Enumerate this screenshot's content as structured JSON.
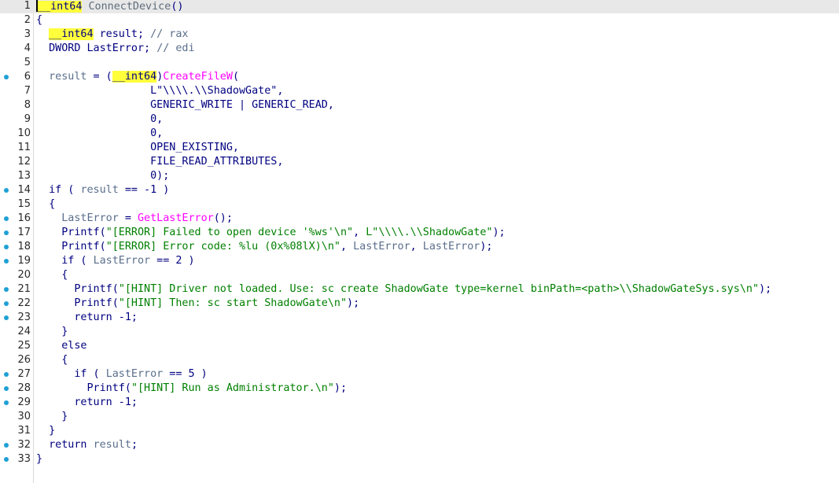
{
  "editor": {
    "lines": [
      {
        "n": "1",
        "marker": false,
        "current": true,
        "tokens": [
          {
            "c": "caret"
          },
          {
            "t": "__int64",
            "c": "typ hl"
          },
          {
            "t": " ",
            "c": "pl"
          },
          {
            "t": "ConnectDevice",
            "c": "fn"
          },
          {
            "t": "()",
            "c": "pl"
          }
        ]
      },
      {
        "n": "2",
        "marker": false,
        "current": false,
        "tokens": [
          {
            "t": "{",
            "c": "pl"
          }
        ]
      },
      {
        "n": "3",
        "marker": false,
        "current": false,
        "tokens": [
          {
            "t": "  ",
            "c": "pl"
          },
          {
            "t": "__int64",
            "c": "typ hl"
          },
          {
            "t": " result; ",
            "c": "pl"
          },
          {
            "t": "// rax",
            "c": "cm"
          }
        ]
      },
      {
        "n": "4",
        "marker": false,
        "current": false,
        "tokens": [
          {
            "t": "  DWORD LastError; ",
            "c": "pl"
          },
          {
            "t": "// edi",
            "c": "cm"
          }
        ]
      },
      {
        "n": "5",
        "marker": false,
        "current": false,
        "tokens": []
      },
      {
        "n": "6",
        "marker": true,
        "current": false,
        "tokens": [
          {
            "t": "  ",
            "c": "pl"
          },
          {
            "t": "result",
            "c": "var"
          },
          {
            "t": " = (",
            "c": "pl"
          },
          {
            "t": "__int64",
            "c": "typ hl"
          },
          {
            "t": ")",
            "c": "pl"
          },
          {
            "t": "CreateFileW",
            "c": "call"
          },
          {
            "t": "(",
            "c": "pl"
          }
        ]
      },
      {
        "n": "7",
        "marker": false,
        "current": false,
        "tokens": [
          {
            "t": "                  ",
            "c": "pl"
          },
          {
            "t": "L\"\\\\\\\\.\\\\ShadowGate\"",
            "c": "pl"
          },
          {
            "t": ",",
            "c": "pl"
          }
        ]
      },
      {
        "n": "8",
        "marker": false,
        "current": false,
        "tokens": [
          {
            "t": "                  GENERIC_WRITE | GENERIC_READ,",
            "c": "pl"
          }
        ]
      },
      {
        "n": "9",
        "marker": false,
        "current": false,
        "tokens": [
          {
            "t": "                  0,",
            "c": "pl"
          }
        ]
      },
      {
        "n": "10",
        "marker": false,
        "current": false,
        "tokens": [
          {
            "t": "                  0,",
            "c": "pl"
          }
        ]
      },
      {
        "n": "11",
        "marker": false,
        "current": false,
        "tokens": [
          {
            "t": "                  OPEN_EXISTING,",
            "c": "pl"
          }
        ]
      },
      {
        "n": "12",
        "marker": false,
        "current": false,
        "tokens": [
          {
            "t": "                  FILE_READ_ATTRIBUTES,",
            "c": "pl"
          }
        ]
      },
      {
        "n": "13",
        "marker": false,
        "current": false,
        "tokens": [
          {
            "t": "                  0);",
            "c": "pl"
          }
        ]
      },
      {
        "n": "14",
        "marker": true,
        "current": false,
        "tokens": [
          {
            "t": "  if ( ",
            "c": "pl"
          },
          {
            "t": "result",
            "c": "var"
          },
          {
            "t": " == -1 )",
            "c": "pl"
          }
        ]
      },
      {
        "n": "15",
        "marker": false,
        "current": false,
        "tokens": [
          {
            "t": "  {",
            "c": "pl"
          }
        ]
      },
      {
        "n": "16",
        "marker": true,
        "current": false,
        "tokens": [
          {
            "t": "    ",
            "c": "pl"
          },
          {
            "t": "LastError",
            "c": "var"
          },
          {
            "t": " = ",
            "c": "pl"
          },
          {
            "t": "GetLastError",
            "c": "call"
          },
          {
            "t": "();",
            "c": "pl"
          }
        ]
      },
      {
        "n": "17",
        "marker": true,
        "current": false,
        "tokens": [
          {
            "t": "    Printf(",
            "c": "pl"
          },
          {
            "t": "\"[ERROR] Failed to open device '%ws'\\n\"",
            "c": "str"
          },
          {
            "t": ", ",
            "c": "pl"
          },
          {
            "t": "L\"\\\\\\\\.\\\\ShadowGate\"",
            "c": "str"
          },
          {
            "t": ");",
            "c": "pl"
          }
        ]
      },
      {
        "n": "18",
        "marker": true,
        "current": false,
        "tokens": [
          {
            "t": "    Printf(",
            "c": "pl"
          },
          {
            "t": "\"[ERROR] Error code: %lu (0x%08lX)\\n\"",
            "c": "str"
          },
          {
            "t": ", ",
            "c": "pl"
          },
          {
            "t": "LastError",
            "c": "var"
          },
          {
            "t": ", ",
            "c": "pl"
          },
          {
            "t": "LastError",
            "c": "var"
          },
          {
            "t": ");",
            "c": "pl"
          }
        ]
      },
      {
        "n": "19",
        "marker": true,
        "current": false,
        "tokens": [
          {
            "t": "    if ( ",
            "c": "pl"
          },
          {
            "t": "LastError",
            "c": "var"
          },
          {
            "t": " == 2 )",
            "c": "pl"
          }
        ]
      },
      {
        "n": "20",
        "marker": false,
        "current": false,
        "tokens": [
          {
            "t": "    {",
            "c": "pl"
          }
        ]
      },
      {
        "n": "21",
        "marker": true,
        "current": false,
        "tokens": [
          {
            "t": "      Printf(",
            "c": "pl"
          },
          {
            "t": "\"[HINT] Driver not loaded. Use: sc create ShadowGate type=kernel binPath=<path>\\\\ShadowGateSys.sys\\n\"",
            "c": "str"
          },
          {
            "t": ");",
            "c": "pl"
          }
        ]
      },
      {
        "n": "22",
        "marker": true,
        "current": false,
        "tokens": [
          {
            "t": "      Printf(",
            "c": "pl"
          },
          {
            "t": "\"[HINT] Then: sc start ShadowGate\\n\"",
            "c": "str"
          },
          {
            "t": ");",
            "c": "pl"
          }
        ]
      },
      {
        "n": "23",
        "marker": true,
        "current": false,
        "tokens": [
          {
            "t": "      return -1;",
            "c": "pl"
          }
        ]
      },
      {
        "n": "24",
        "marker": false,
        "current": false,
        "tokens": [
          {
            "t": "    }",
            "c": "pl"
          }
        ]
      },
      {
        "n": "25",
        "marker": false,
        "current": false,
        "tokens": [
          {
            "t": "    else",
            "c": "pl"
          }
        ]
      },
      {
        "n": "26",
        "marker": false,
        "current": false,
        "tokens": [
          {
            "t": "    {",
            "c": "pl"
          }
        ]
      },
      {
        "n": "27",
        "marker": true,
        "current": false,
        "tokens": [
          {
            "t": "      if ( ",
            "c": "pl"
          },
          {
            "t": "LastError",
            "c": "var"
          },
          {
            "t": " == 5 )",
            "c": "pl"
          }
        ]
      },
      {
        "n": "28",
        "marker": true,
        "current": false,
        "tokens": [
          {
            "t": "        Printf(",
            "c": "pl"
          },
          {
            "t": "\"[HINT] Run as Administrator.\\n\"",
            "c": "str"
          },
          {
            "t": ");",
            "c": "pl"
          }
        ]
      },
      {
        "n": "29",
        "marker": true,
        "current": false,
        "tokens": [
          {
            "t": "      return -1;",
            "c": "pl"
          }
        ]
      },
      {
        "n": "30",
        "marker": false,
        "current": false,
        "tokens": [
          {
            "t": "    }",
            "c": "pl"
          }
        ]
      },
      {
        "n": "31",
        "marker": false,
        "current": false,
        "tokens": [
          {
            "t": "  }",
            "c": "pl"
          }
        ]
      },
      {
        "n": "32",
        "marker": true,
        "current": false,
        "tokens": [
          {
            "t": "  return ",
            "c": "pl"
          },
          {
            "t": "result",
            "c": "var"
          },
          {
            "t": ";",
            "c": "pl"
          }
        ]
      },
      {
        "n": "33",
        "marker": true,
        "current": false,
        "tokens": [
          {
            "t": "}",
            "c": "pl"
          }
        ]
      }
    ]
  },
  "colors": {
    "keyword": "#000080",
    "string": "#008000",
    "call": "#ff00ff",
    "variable": "#5a6e8c",
    "highlight": "#ffff3c",
    "breakpoint_marker": "#1ea0d6",
    "current_line": "#e8e8e8"
  }
}
